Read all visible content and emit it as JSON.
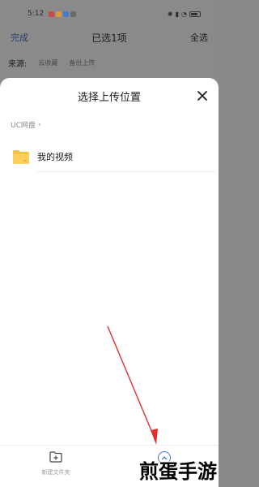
{
  "statusbar": {
    "time": "5:12"
  },
  "topbar": {
    "done_label": "完成",
    "title": "已选1项",
    "select_all_label": "全选"
  },
  "source": {
    "label": "来源:",
    "chips": [
      "云收藏",
      "备份上传"
    ]
  },
  "sheet": {
    "title": "选择上传位置",
    "breadcrumb": {
      "root": "UC网盘",
      "separator": "›"
    },
    "folders": [
      {
        "name": "我的视频"
      }
    ],
    "bottom": {
      "new_folder_label": "新建文件夹"
    }
  },
  "watermark": "煎蛋手游",
  "colors": {
    "accent": "#3b6fd4",
    "folder": "#f5c242",
    "arrow": "#e0302e"
  }
}
